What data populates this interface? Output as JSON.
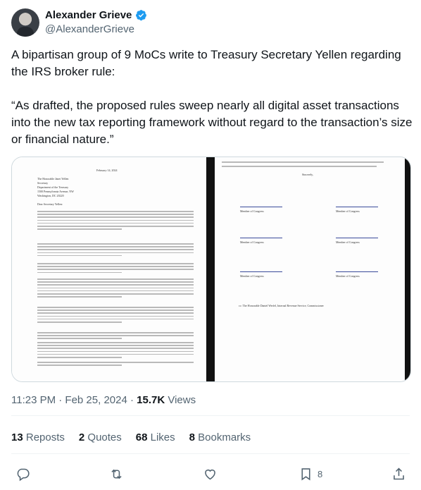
{
  "author": {
    "name": "Alexander Grieve",
    "handle": "@AlexanderGrieve",
    "avatar_icon": "profile-photo",
    "verified_color": "#1d9bf0"
  },
  "tweet": {
    "text": "A bipartisan group of 9 MoCs write to Treasury Secretary Yellen regarding the IRS broker rule:\n\n“As drafted, the proposed rules sweep nearly all digital asset transactions into the new tax reporting framework without regard to the transaction’s size or financial nature.”"
  },
  "media": {
    "left_page": {
      "date": "February 14, 2024",
      "addressee": "The Honorable Janet Yellen\nSecretary\nDepartment of the Treasury\n1500 Pennsylvania Avenue, NW\nWashington, DC 20220",
      "salutation": "Dear Secretary Yellen:"
    },
    "right_page": {
      "closing": "Sincerely,",
      "signatories": [
        "Member of Congress",
        "Member of Congress",
        "Member of Congress",
        "Member of Congress",
        "Member of Congress",
        "Member of Congress"
      ],
      "cc": "cc: The Honorable Daniel Werfel, Internal Revenue Service, Commissioner"
    }
  },
  "meta": {
    "time": "11:23 PM · Feb 25, 2024 · ",
    "views_count": "15.7K",
    "views_label": " Views"
  },
  "stats": {
    "reposts_count": "13",
    "reposts_label": " Reposts",
    "quotes_count": "2",
    "quotes_label": " Quotes",
    "likes_count": "68",
    "likes_label": " Likes",
    "bookmarks_count": "8",
    "bookmarks_label": " Bookmarks"
  },
  "actions": {
    "reply_icon": "reply-icon",
    "repost_icon": "repost-icon",
    "like_icon": "like-icon",
    "bookmark_icon": "bookmark-icon",
    "bookmark_count": "8",
    "share_icon": "share-icon"
  }
}
